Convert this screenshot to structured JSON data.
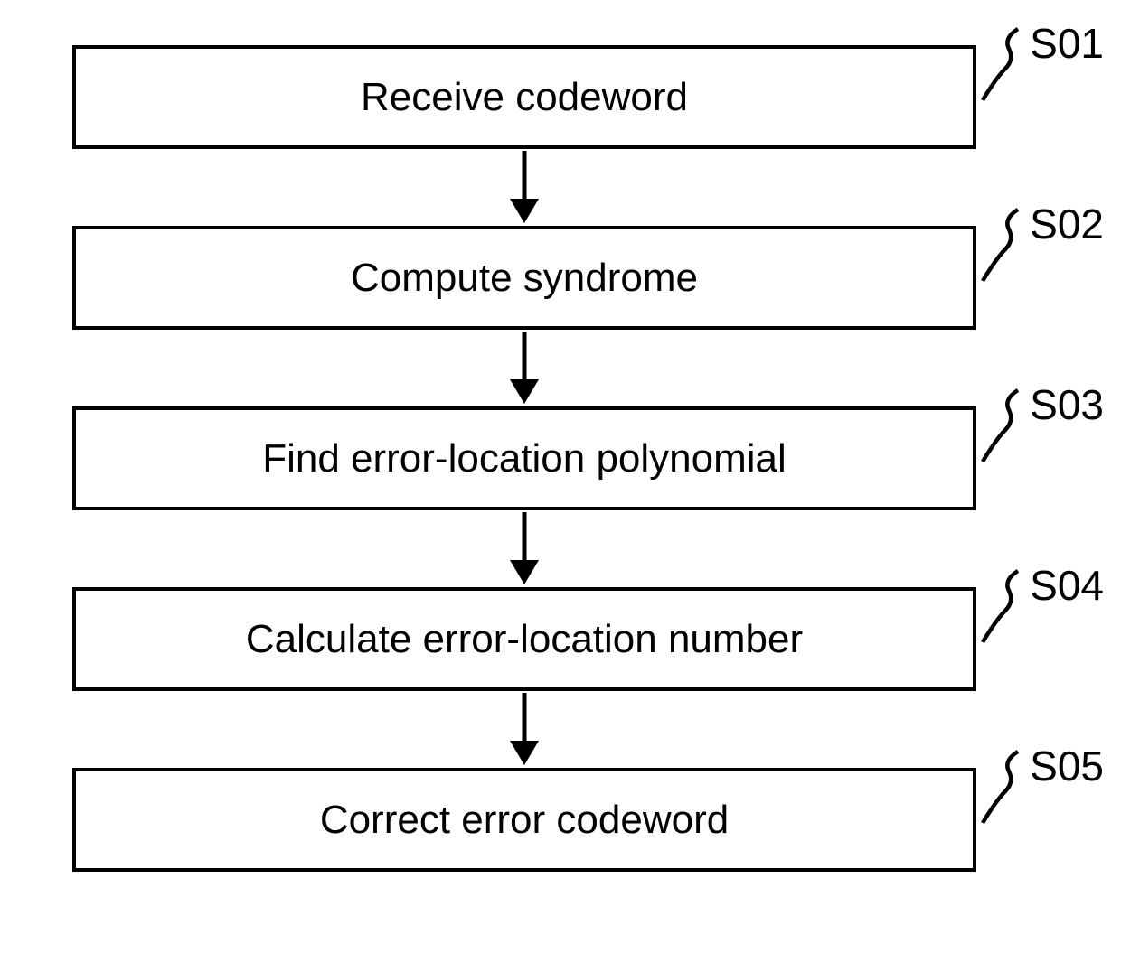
{
  "flowchart": {
    "steps": [
      {
        "id": "S01",
        "text": "Receive codeword"
      },
      {
        "id": "S02",
        "text": "Compute syndrome"
      },
      {
        "id": "S03",
        "text": "Find error-location polynomial"
      },
      {
        "id": "S04",
        "text": "Calculate error-location number"
      },
      {
        "id": "S05",
        "text": "Correct error codeword"
      }
    ]
  }
}
